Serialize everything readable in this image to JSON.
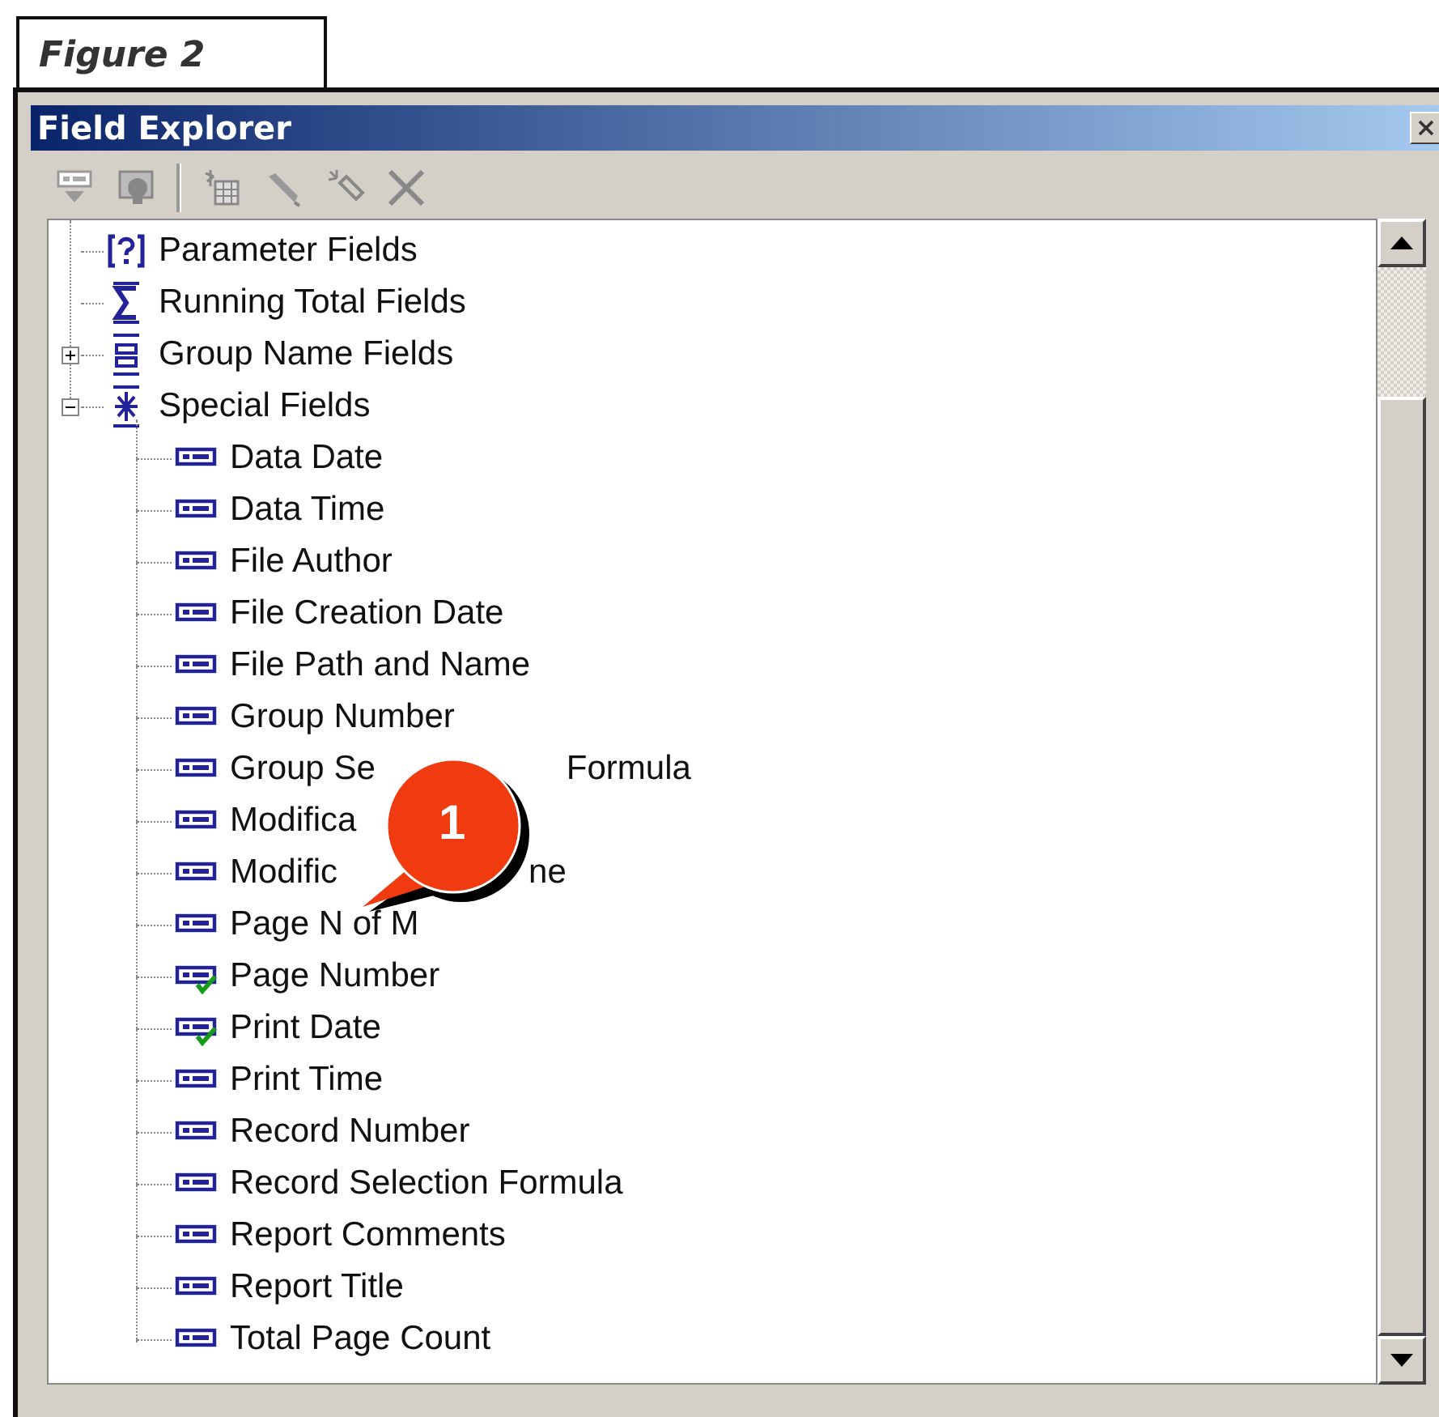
{
  "figure_caption": "Figure 2",
  "window": {
    "title": "Field Explorer"
  },
  "toolbar": [
    {
      "kind": "insert"
    },
    {
      "kind": "browse"
    },
    {
      "kind": "new"
    },
    {
      "kind": "edit"
    },
    {
      "kind": "rename"
    },
    {
      "kind": "delete"
    }
  ],
  "tree": [
    {
      "label": "Parameter Fields",
      "kind": "parameter"
    },
    {
      "label": "Running Total Fields",
      "kind": "running-total"
    },
    {
      "label": "Group Name Fields",
      "kind": "group-name",
      "expanded": false
    },
    {
      "label": "Special Fields",
      "kind": "special",
      "expanded": true,
      "children": [
        {
          "label": "Data Date",
          "used": false
        },
        {
          "label": "Data Time",
          "used": false
        },
        {
          "label": "File Author",
          "used": false
        },
        {
          "label": "File Creation Date",
          "used": false
        },
        {
          "label": "File Path and Name",
          "used": false
        },
        {
          "label": "Group Number",
          "used": false
        },
        {
          "label": "Group Se",
          "label_after": "Formula",
          "used": false
        },
        {
          "label": "Modifica",
          "used": false
        },
        {
          "label": "Modific",
          "label_after": "ne",
          "used": false
        },
        {
          "label": "Page N of M",
          "used": false
        },
        {
          "label": "Page Number",
          "used": true
        },
        {
          "label": "Print Date",
          "used": true
        },
        {
          "label": "Print Time",
          "used": false
        },
        {
          "label": "Record Number",
          "used": false
        },
        {
          "label": "Record Selection Formula",
          "used": false
        },
        {
          "label": "Report Comments",
          "used": false
        },
        {
          "label": "Report Title",
          "used": false
        },
        {
          "label": "Total Page Count",
          "used": false
        }
      ]
    }
  ],
  "callout": {
    "label": "1"
  }
}
